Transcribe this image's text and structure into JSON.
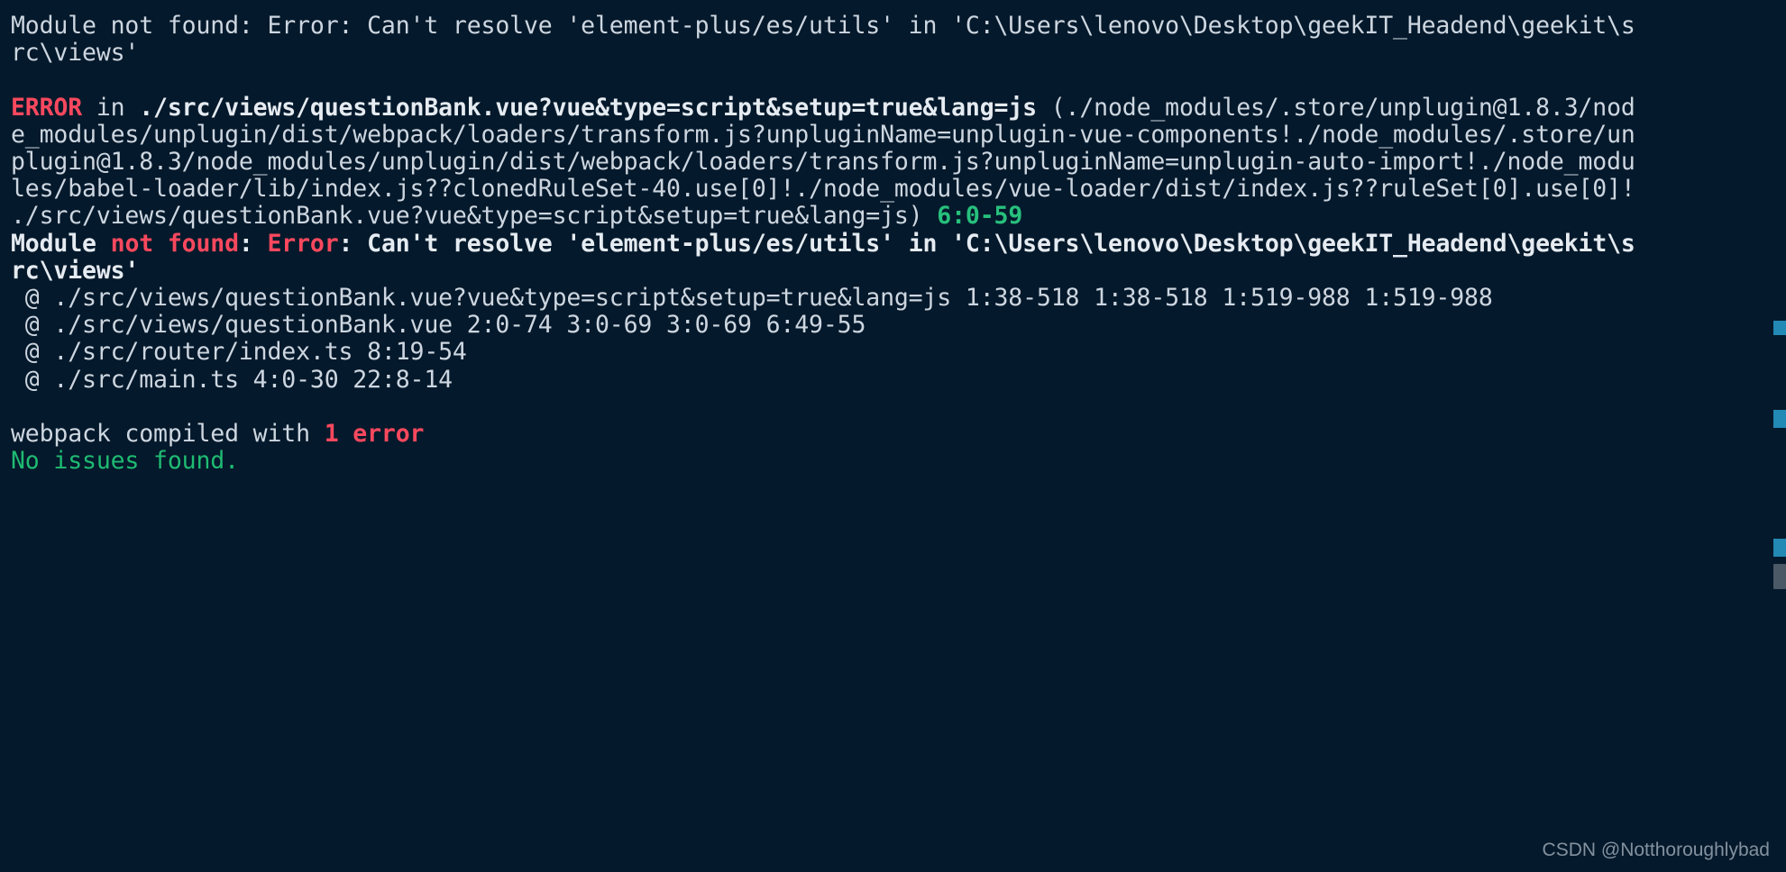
{
  "terminal": {
    "background_color": "#04192b",
    "default_text_color": "#d8dee9",
    "accent_colors": {
      "error_red": "#f8485e",
      "success_green": "#27c07d",
      "scroll_marker_blue": "#2389b5",
      "scroll_thumb_gray": "#4b5866"
    },
    "lines": {
      "l1": "Module not found: Error: Can't resolve 'element-plus/es/utils' in 'C:\\Users\\lenovo\\Desktop\\geekIT_Headend\\geekit\\s",
      "l2": "rc\\views'",
      "l3_error_label": "ERROR",
      "l3_in": " in ",
      "l3_module": "./src/views/questionBank.vue?vue&type=script&setup=true&lang=js",
      "l3_rest": " (./node_modules/.store/unplugin@1.8.3/nod",
      "l4": "e_modules/unplugin/dist/webpack/loaders/transform.js?unpluginName=unplugin-vue-components!./node_modules/.store/un",
      "l5": "plugin@1.8.3/node_modules/unplugin/dist/webpack/loaders/transform.js?unpluginName=unplugin-auto-import!./node_modu",
      "l6": "les/babel-loader/lib/index.js??clonedRuleSet-40.use[0]!./node_modules/vue-loader/dist/index.js??ruleSet[0].use[0]!",
      "l7_path": "./src/views/questionBank.vue?vue&type=script&setup=true&lang=js) ",
      "l7_loc": "6:0-59",
      "l8_module": "Module ",
      "l8_notfound": "not found",
      "l8_colon": ": ",
      "l8_error": "Error",
      "l8_rest": ": Can't resolve 'element-plus/es/utils' in 'C:\\Users\\lenovo\\Desktop\\geekIT_Headend\\geekit\\s",
      "l9": "rc\\views'",
      "l10": " @ ./src/views/questionBank.vue?vue&type=script&setup=true&lang=js 1:38-518 1:38-518 1:519-988 1:519-988",
      "l11": " @ ./src/views/questionBank.vue 2:0-74 3:0-69 3:0-69 6:49-55",
      "l12": " @ ./src/router/index.ts 8:19-54",
      "l13": " @ ./src/main.ts 4:0-30 22:8-14",
      "l14_prefix": "webpack compiled with ",
      "l14_count": "1 error",
      "l15": "No issues found."
    },
    "watermark": "CSDN @Notthoroughlybad"
  }
}
